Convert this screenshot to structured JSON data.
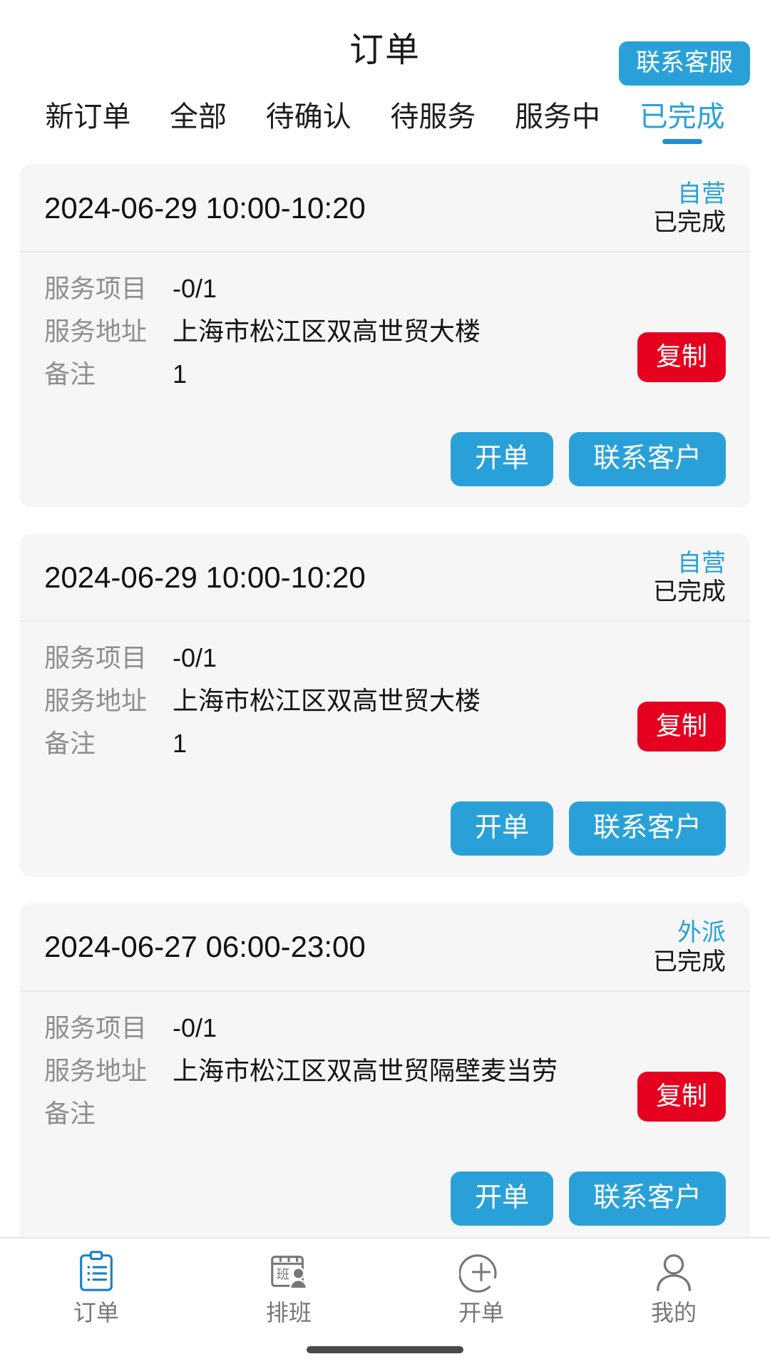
{
  "header": {
    "title": "订单",
    "contact_service_label": "联系客服"
  },
  "tabs": [
    {
      "label": "新订单",
      "active": false
    },
    {
      "label": "全部",
      "active": false
    },
    {
      "label": "待确认",
      "active": false
    },
    {
      "label": "待服务",
      "active": false
    },
    {
      "label": "服务中",
      "active": false
    },
    {
      "label": "已完成",
      "active": true
    }
  ],
  "labels": {
    "service_item": "服务项目",
    "service_address": "服务地址",
    "remark": "备注",
    "copy": "复制",
    "create_order": "开单",
    "contact_customer": "联系客户"
  },
  "orders": [
    {
      "datetime": "2024-06-29 10:00-10:20",
      "channel": "自营",
      "status": "已完成",
      "service_item": "-0/1",
      "service_address": "上海市松江区双高世贸大楼",
      "remark": "1"
    },
    {
      "datetime": "2024-06-29 10:00-10:20",
      "channel": "自营",
      "status": "已完成",
      "service_item": "-0/1",
      "service_address": "上海市松江区双高世贸大楼",
      "remark": "1"
    },
    {
      "datetime": "2024-06-27 06:00-23:00",
      "channel": "外派",
      "status": "已完成",
      "service_item": "-0/1",
      "service_address": "上海市松江区双高世贸隔壁麦当劳",
      "remark": ""
    }
  ],
  "bottom_nav": [
    {
      "label": "订单",
      "icon": "clipboard-list-icon",
      "active": true
    },
    {
      "label": "排班",
      "icon": "schedule-person-icon",
      "active": false
    },
    {
      "label": "开单",
      "icon": "plus-circle-icon",
      "active": false
    },
    {
      "label": "我的",
      "icon": "person-icon",
      "active": false
    }
  ],
  "colors": {
    "accent_blue": "#29a1d8",
    "danger_red": "#e60020",
    "card_bg": "#f6f6f6",
    "label_gray": "#8e8e8e",
    "nav_gray": "#777777"
  }
}
